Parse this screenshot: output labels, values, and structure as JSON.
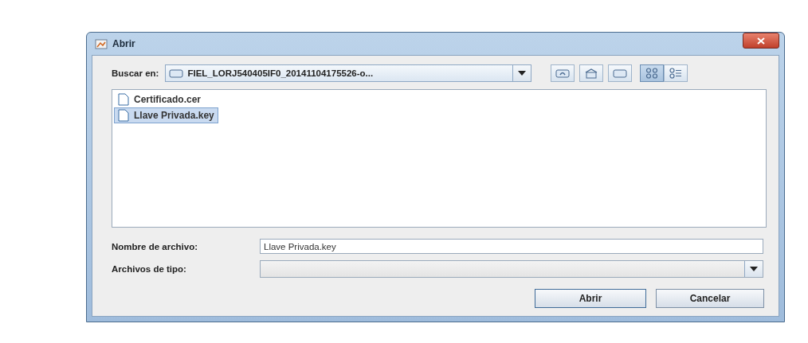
{
  "window": {
    "title": "Abrir"
  },
  "look_in": {
    "label": "Buscar en:",
    "value": "FIEL_LORJ540405IF0_20141104175526-o..."
  },
  "toolbar": [
    {
      "kind": "up",
      "selected": false
    },
    {
      "kind": "home",
      "selected": false
    },
    {
      "kind": "new-folder",
      "selected": false
    },
    {
      "kind": "list",
      "selected": true
    },
    {
      "kind": "details",
      "selected": false
    }
  ],
  "files": [
    {
      "name": "Certificado.cer",
      "selected": false
    },
    {
      "name": "Llave Privada.key",
      "selected": true
    }
  ],
  "file_name": {
    "label": "Nombre de archivo:",
    "value": "Llave Privada.key"
  },
  "file_type": {
    "label": "Archivos de tipo:"
  },
  "buttons": [
    "Abrir",
    "Cancelar"
  ]
}
